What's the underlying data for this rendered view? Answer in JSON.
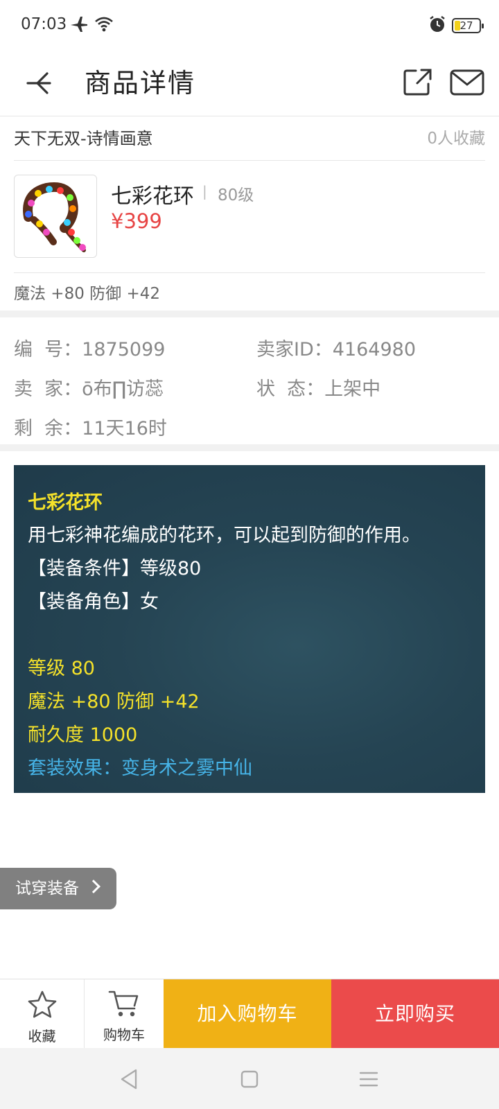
{
  "status_bar": {
    "time": "07:03",
    "battery": "27",
    "icons": [
      "airplane-icon",
      "wifi-icon",
      "alarm-icon",
      "battery-icon"
    ]
  },
  "header": {
    "title": "商品详情"
  },
  "store": {
    "name": "天下无双-诗情画意",
    "fav_count": "0人收藏"
  },
  "item": {
    "name": "七彩花环",
    "separator": "|",
    "level": "80级",
    "price": "¥399",
    "stats": "魔法 +80 防御 +42"
  },
  "info": {
    "serial_label": "编  号：",
    "serial_value": "1875099",
    "seller_id_label": "卖家ID：",
    "seller_id_value": "4164980",
    "seller_label": "卖  家：",
    "seller_value": "ō布∏访蕊",
    "status_label": "状  态：",
    "status_value": "上架中",
    "remaining_label": "剩  余：",
    "remaining_value": "11天16时"
  },
  "description": {
    "title": "七彩花环",
    "text": "用七彩神花编成的花环，可以起到防御的作用。",
    "condition": "【装备条件】等级80",
    "role": "【装备角色】女",
    "level": "等级 80",
    "stats": "魔法 +80 防御 +42",
    "durability": "耐久度 1000",
    "set_effect": "套装效果：变身术之雾中仙"
  },
  "try_on": {
    "label": "试穿装备"
  },
  "actions": {
    "favorite": "收藏",
    "cart": "购物车",
    "add_to_cart": "加入购物车",
    "buy_now": "立即购买"
  },
  "colors": {
    "price_red": "#e74444",
    "add_cart_yellow": "#f0b115",
    "buy_red": "#eb4b4b",
    "desc_yellow": "#f5e22a",
    "desc_cyan": "#46b4e8",
    "desc_bg": "#254453"
  }
}
